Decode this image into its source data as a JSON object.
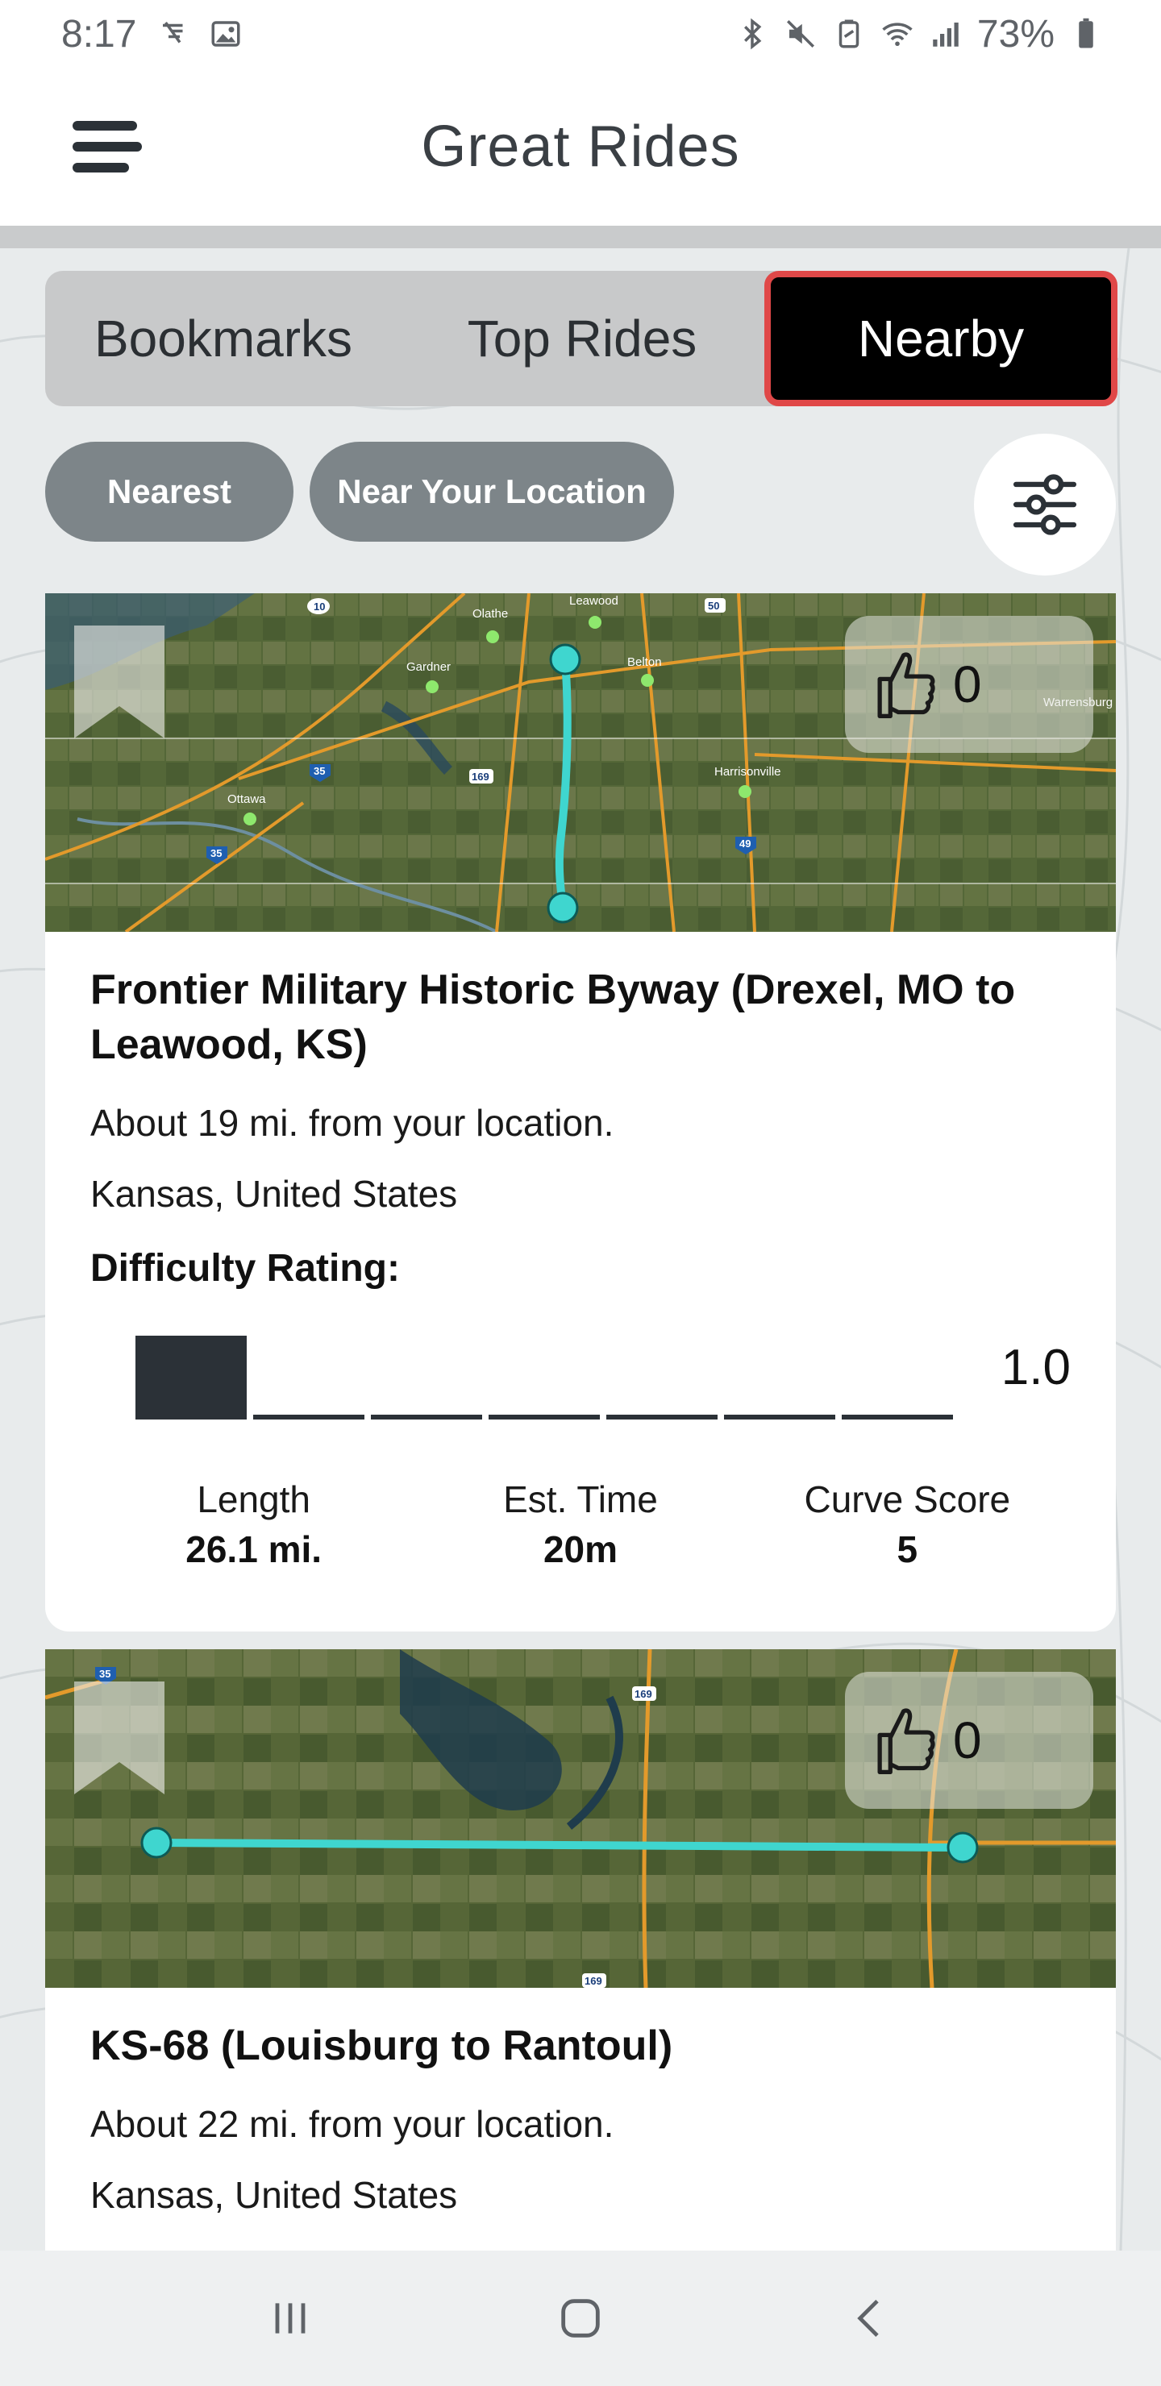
{
  "status_bar": {
    "time": "8:17",
    "battery": "73%"
  },
  "app_bar": {
    "title": "Great Rides"
  },
  "tabs": [
    {
      "label": "Bookmarks",
      "active": false
    },
    {
      "label": "Top Rides",
      "active": false
    },
    {
      "label": "Nearby",
      "active": true
    }
  ],
  "filters": {
    "nearest": "Nearest",
    "near_location": "Near Your Location"
  },
  "rides": [
    {
      "map_labels": [
        "Olathe",
        "Leawood",
        "Gardner",
        "Belton",
        "Harrisonville",
        "Ottawa",
        "Warrensburg",
        "10",
        "50",
        "35",
        "169",
        "49",
        "35"
      ],
      "likes": "0",
      "title": "Frontier Military Historic Byway (Drexel, MO to Leawood, KS)",
      "distance": "About 19 mi. from your location.",
      "region": "Kansas, United States",
      "difficulty_label": "Difficulty Rating:",
      "difficulty": 1.0,
      "difficulty_text": "1.0",
      "difficulty_max": 7,
      "stats": [
        {
          "label": "Length",
          "value": "26.1 mi."
        },
        {
          "label": "Est. Time",
          "value": "20m"
        },
        {
          "label": "Curve Score",
          "value": "5"
        }
      ]
    },
    {
      "map_labels": [
        "35",
        "169",
        "169"
      ],
      "likes": "0",
      "title": "KS-68 (Louisburg to Rantoul)",
      "distance": "About 22 mi. from your location.",
      "region": "Kansas, United States"
    }
  ],
  "colors": {
    "route": "#3fd6cf",
    "road": "#e39a2b",
    "active_tab_border": "#e04848",
    "chip": "#7d8589"
  },
  "icons": {
    "status_left": [
      "signal-calendar-icon",
      "image-icon"
    ],
    "status_right": [
      "bluetooth-icon",
      "mute-icon",
      "battery-saver-icon",
      "wifi-icon",
      "cell-signal-icon",
      "battery-icon"
    ],
    "nav": [
      "recents-icon",
      "home-icon",
      "back-icon"
    ]
  }
}
